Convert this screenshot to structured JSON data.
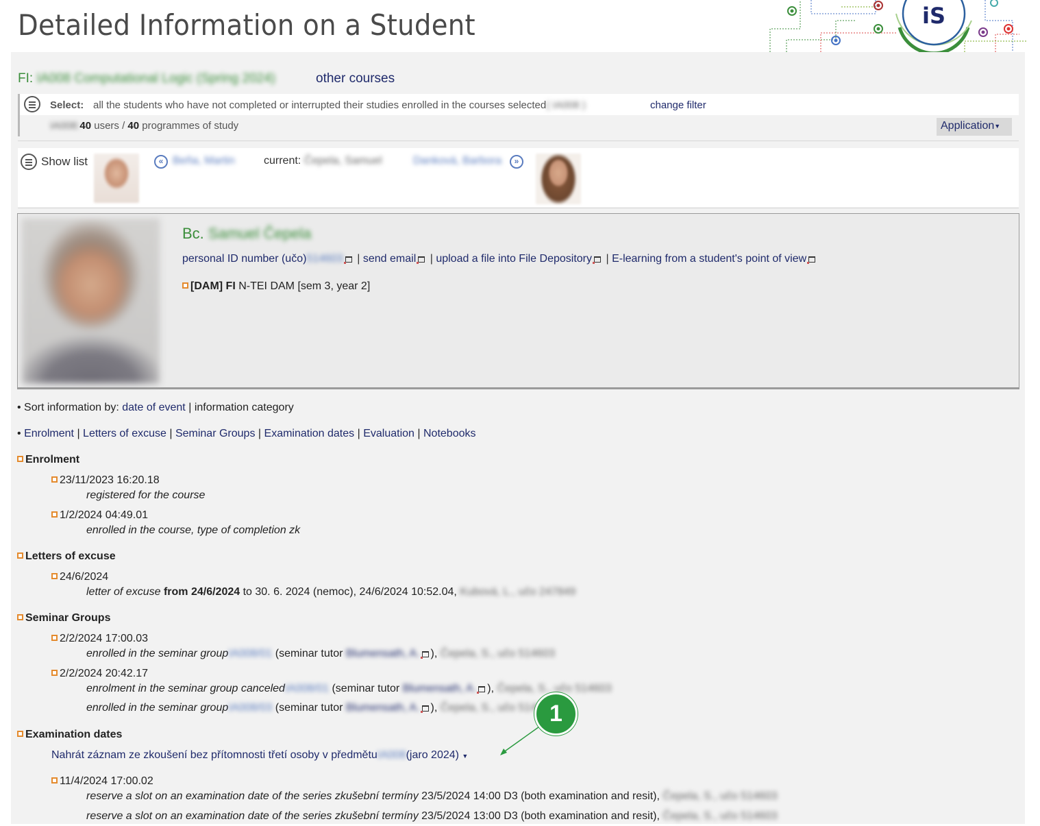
{
  "header": {
    "title": "Detailed Information on a Student",
    "logo_text": "iS"
  },
  "course": {
    "prefix": "FI:",
    "name": "IA008 Computational Logic (Spring 2024)",
    "other_courses": "other courses"
  },
  "filter": {
    "select_label": "Select:",
    "select_text": "all the students who have not completed or interrupted their studies enrolled in the courses selected",
    "select_course_code": "( IA008 )",
    "change_filter": "change filter",
    "users_code": "IA008:",
    "users_count": "40",
    "users_word": "users /",
    "programmes_count": "40",
    "programmes_word": "programmes of study",
    "application_button": "Application"
  },
  "navigation": {
    "show_list": "Show list",
    "prev_student": "Beňa, Martin",
    "current_label": "current:",
    "current_student": "Čepela, Samuel",
    "next_student": "Danková, Barbora"
  },
  "profile": {
    "degree": "Bc.",
    "name": "Samuel Čepela",
    "uco_label": "personal ID number (učo)",
    "uco": "514603",
    "sep": "|",
    "send_email": "send email",
    "upload_file": "upload a file into File Depository",
    "elearning": "E-learning from a student's point of view",
    "programme_bold": "[DAM] FI",
    "programme_rest": "N-TEI DAM [sem 3, year 2]"
  },
  "sort": {
    "label": "• Sort information by:",
    "by_date": "date of event",
    "sep": "|",
    "by_category": "information category"
  },
  "quicklinks": {
    "bullet": "•",
    "sep": "|",
    "items": [
      "Enrolment",
      "Letters of excuse",
      "Seminar Groups",
      "Examination dates",
      "Evaluation",
      "Notebooks"
    ]
  },
  "enrolment": {
    "heading": "Enrolment",
    "entries": [
      {
        "date": "23/11/2023 16:20.18",
        "text": "registered for the course"
      },
      {
        "date": "1/2/2024 04:49.01",
        "text": "enrolled in the course, type of completion zk"
      }
    ]
  },
  "letters": {
    "heading": "Letters of excuse",
    "date": "24/6/2024",
    "desc": "letter of excuse",
    "from_bold": "from 24/6/2024",
    "rest": "to 30. 6. 2024 (nemoc), 24/6/2024 10:52.04,",
    "author": "Kubová, L., učo 247849"
  },
  "seminar": {
    "heading": "Seminar Groups",
    "entries": [
      {
        "date": "2/2/2024 17:00.03",
        "desc": "enrolled in the seminar group",
        "group": "IA008/01",
        "tutor_label": "(seminar tutor",
        "tutor": "Blumensath, A.",
        "close": "),",
        "who": "Čepela, S., učo 514603"
      },
      {
        "date": "2/2/2024 20:42.17",
        "desc": "enrolment in the seminar group canceled",
        "group": "IA008/01",
        "tutor_label": "(seminar tutor",
        "tutor": "Blumensath, A.",
        "close": "),",
        "who": "Čepela, S., učo 514603"
      },
      {
        "date": "",
        "desc": "enrolled in the seminar group",
        "group": "IA008/03",
        "tutor_label": "(seminar tutor",
        "tutor": "Blumensath, A.",
        "close": "),",
        "who": "Čepela, S., učo 514603"
      }
    ]
  },
  "exams": {
    "heading": "Examination dates",
    "upload_link": "Nahrát záznam ze zkoušení bez přítomnosti třetí osoby v předmětu",
    "upload_code": "IA008",
    "upload_tail": "(jaro 2024)",
    "entry_date": "11/4/2024 17:00.02",
    "rows": [
      {
        "desc": "reserve a slot on an examination date of the series zkušební termíny",
        "rest": "23/5/2024 14:00 D3 (both examination and resit),",
        "who": "Čepela, S., učo 514603"
      },
      {
        "desc": "reserve a slot on an examination date of the series zkušební termíny",
        "rest": "23/5/2024 13:00 D3 (both examination and resit),",
        "who": "Čepela, S., učo 514603"
      }
    ]
  },
  "callout": {
    "number": "1"
  },
  "colors": {
    "green": "#3b8e3b",
    "link": "#1f2a6b",
    "bullet": "#e48a2d",
    "callout": "#2a9a3f"
  }
}
